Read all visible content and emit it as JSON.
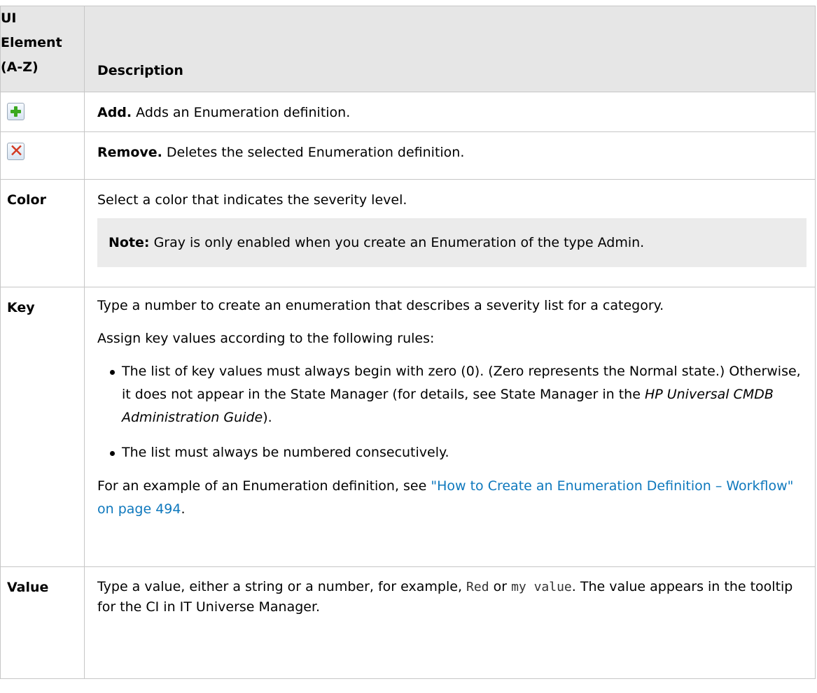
{
  "header": {
    "col1": "UI Element (A-Z)",
    "col1_line1": "UI",
    "col1_line2": "Element",
    "col1_line3": "(A-Z)",
    "col2": "Description"
  },
  "rows": {
    "add": {
      "icon": "add-icon",
      "title": "Add.",
      "text": " Adds an Enumeration definition."
    },
    "remove": {
      "icon": "remove-icon",
      "title": "Remove.",
      "text": " Deletes the selected Enumeration definition."
    },
    "color": {
      "name": "Color",
      "text": "Select a color that indicates the severity level.",
      "note_label": "Note:",
      "note_text": " Gray is only enabled when you create an Enumeration of the type Admin."
    },
    "key": {
      "name": "Key",
      "p1": "Type a number to create an enumeration that describes a severity list for a category.",
      "p2": "Assign key values according to the following rules:",
      "bullet1_a": "The list of key values must always begin with zero (0). (Zero represents the Normal state.) Otherwise, it does not appear in the State Manager (for details, see State Manager in the ",
      "bullet1_italic": "HP Universal CMDB Administration Guide",
      "bullet1_b": ").",
      "bullet2": "The list must always be numbered consecutively.",
      "p3_a": "For an example of an Enumeration definition, see ",
      "p3_link": "\"How to Create an Enumeration Definition – Workflow\" on page 494",
      "p3_b": "."
    },
    "value": {
      "name": "Value",
      "a": "Type a value, either a string or a number, for example, ",
      "code1": "Red",
      "b": " or ",
      "code2": "my value",
      "c": ". The value appears in the tooltip for the CI in IT Universe Manager."
    }
  }
}
